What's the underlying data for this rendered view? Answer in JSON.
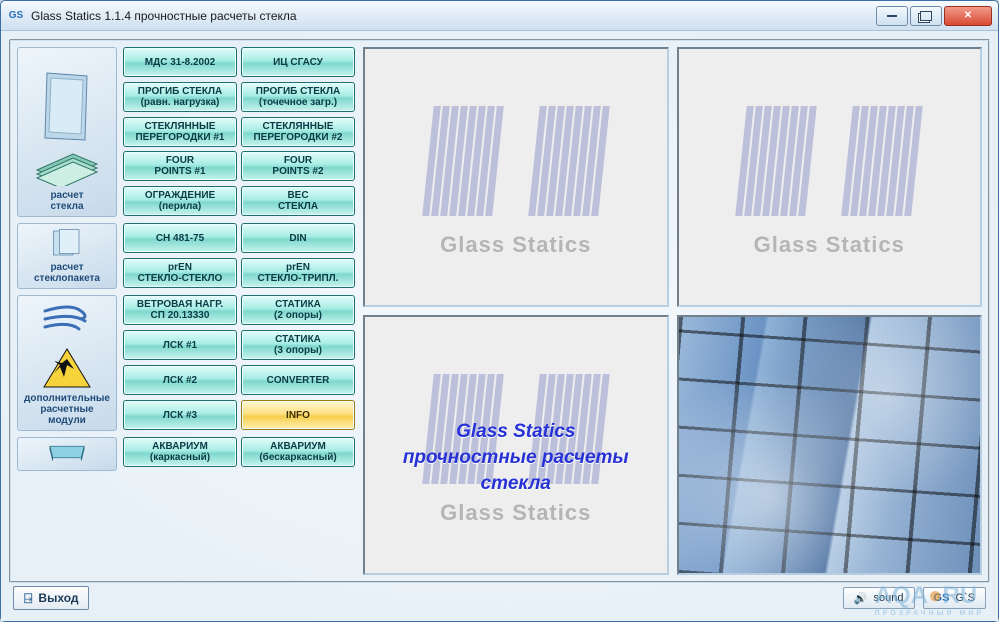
{
  "window": {
    "title": "Glass Statics 1.1.4 прочностные расчеты стекла",
    "logo": "GS"
  },
  "sections": {
    "glass": {
      "label": "расчет\nстекла"
    },
    "unit": {
      "label": "расчет\nстеклопакета"
    },
    "extra": {
      "label": "дополнительные\nрасчетные\nмодули"
    }
  },
  "buttons": {
    "glass": [
      {
        "l": "МДС 31-8.2002"
      },
      {
        "l": "ИЦ СГАСУ"
      },
      {
        "l": "ПРОГИБ СТЕКЛА\n(равн. нагрузка)"
      },
      {
        "l": "ПРОГИБ СТЕКЛА\n(точечное загр.)"
      },
      {
        "l": "СТЕКЛЯННЫЕ\nПЕРЕГОРОДКИ #1"
      },
      {
        "l": "СТЕКЛЯННЫЕ\nПЕРЕГОРОДКИ #2"
      },
      {
        "l": "FOUR\nPOINTS #1"
      },
      {
        "l": "FOUR\nPOINTS #2"
      },
      {
        "l": "ОГРАЖДЕНИЕ\n(перила)"
      },
      {
        "l": "ВЕС\nСТЕКЛА"
      }
    ],
    "unit": [
      {
        "l": "СН 481-75"
      },
      {
        "l": "DIN"
      },
      {
        "l": "prEN\nСТЕКЛО-СТЕКЛО"
      },
      {
        "l": "prEN\nСТЕКЛО-ТРИПЛ."
      }
    ],
    "extra": [
      {
        "l": "ВЕТРОВАЯ НАГР.\nСП 20.13330"
      },
      {
        "l": "СТАТИКА\n(2 опоры)"
      },
      {
        "l": "ЛСК #1"
      },
      {
        "l": "СТАТИКА\n(3 опоры)"
      },
      {
        "l": "ЛСК #2"
      },
      {
        "l": "CONVERTER"
      },
      {
        "l": "ЛСК #3"
      },
      {
        "l": "INFO",
        "variant": "yellow"
      }
    ],
    "aquarium": [
      {
        "l": "АКВАРИУМ\n(каркасный)"
      },
      {
        "l": "АКВАРИУМ\n(бескаркасный)"
      }
    ]
  },
  "panels": {
    "caption": "Glass Statics",
    "overlay": "Glass Statics\nпрочностные расчеты\nстекла"
  },
  "footer": {
    "exit": "Выход",
    "sound": "sound",
    "gs": "G`S"
  },
  "watermark": {
    "main": "AQA",
    "dot": "●",
    "tail": "RU",
    "sub": "ПРОЗРАЧНЫЙ МИР"
  }
}
